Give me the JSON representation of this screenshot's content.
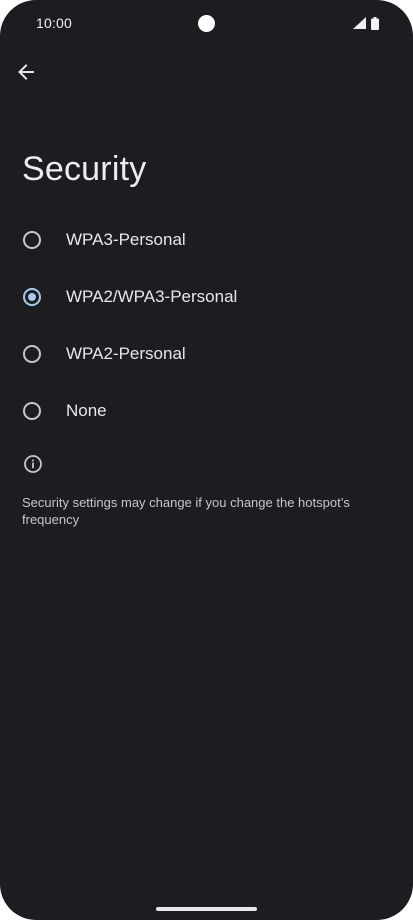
{
  "status_bar": {
    "time": "10:00",
    "icons": [
      "signal-icon",
      "battery-icon"
    ]
  },
  "header": {
    "back_icon": "arrow-left-icon"
  },
  "page": {
    "title": "Security"
  },
  "options": [
    {
      "label": "WPA3-Personal",
      "selected": false
    },
    {
      "label": "WPA2/WPA3-Personal",
      "selected": true
    },
    {
      "label": "WPA2-Personal",
      "selected": false
    },
    {
      "label": "None",
      "selected": false
    }
  ],
  "info": {
    "icon": "info-icon",
    "text": "Security settings may change if you change the hotspot’s frequency"
  },
  "colors": {
    "background": "#1b1d20",
    "accent": "#a8c8f0",
    "text_primary": "#e6e7ea",
    "text_secondary": "#c4c6ca"
  }
}
